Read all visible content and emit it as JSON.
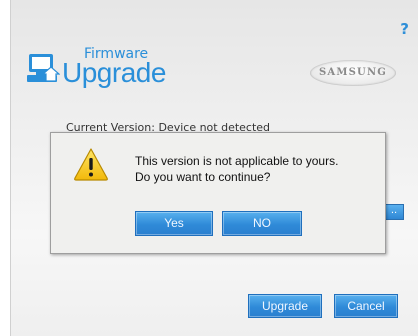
{
  "app": {
    "help_symbol": "?",
    "logo_small": "Firmware",
    "logo_large": "Upgrade",
    "brand": "SAMSUNG",
    "partial_text": "Current Version: Device not detected",
    "browse_label": "..",
    "upgrade_label": "Upgrade",
    "cancel_label": "Cancel"
  },
  "dialog": {
    "icon": "warning-icon",
    "message_line1": "This version is not applicable to yours.",
    "message_line2": "Do you want to continue?",
    "yes_label": "Yes",
    "no_label": "NO"
  },
  "colors": {
    "accent": "#2a8fd9",
    "button_top": "#58b0ee",
    "button_bottom": "#2a7fcf",
    "warning": "#f2c40f"
  }
}
